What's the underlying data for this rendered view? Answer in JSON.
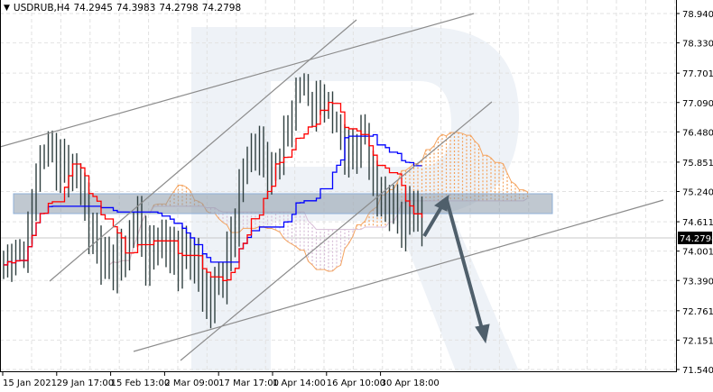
{
  "header": {
    "symbol": "USDRUB,H4",
    "open": "74.2945",
    "high": "74.3983",
    "low": "74.2798",
    "close": "74.2798"
  },
  "colors": {
    "bars": "#2f3f3f",
    "tenkan": "#ff0000",
    "kijun": "#0000ff",
    "cloud_up": "#f4a460",
    "cloud_down": "#d8bfd8",
    "trendline": "#8c8c8c",
    "arrow": "#4f5f6b",
    "zone": "#9aaab8"
  },
  "chart_data": {
    "type": "ohlc",
    "title": "USDRUB,H4",
    "indicator": "Ichimoku Kinko Hyo",
    "ylim": [
      71.5405,
      78.9405
    ],
    "y_ticks": [
      "78.9405",
      "78.3300",
      "77.7010",
      "77.0905",
      "76.4800",
      "75.8510",
      "75.2405",
      "74.6115",
      "74.0010",
      "73.3905",
      "72.7615",
      "72.1510",
      "71.5405"
    ],
    "y_tick_values": [
      78.9405,
      78.33,
      77.701,
      77.0905,
      76.48,
      75.851,
      75.2405,
      74.6115,
      74.001,
      73.3905,
      72.7615,
      72.151,
      71.5405
    ],
    "current_price": "74.2798",
    "x_ticks": [
      "15 Jan 2021",
      "29 Jan 17:00",
      "15 Feb 13:00",
      "2 Mar 09:00",
      "17 Mar 17:00",
      "1 Apr 14:00",
      "16 Apr 10:00",
      "30 Apr 18:00"
    ],
    "price_path": [
      73.79,
      73.98,
      73.88,
      74.54,
      75.66,
      76.13,
      76.04,
      75.85,
      75.66,
      75.47,
      74.91,
      74.16,
      73.79,
      73.6,
      73.98,
      73.79,
      74.73,
      74.07,
      73.88,
      74.16,
      73.98,
      73.88,
      73.88,
      73.79,
      73.41,
      72.85,
      73.23,
      73.6,
      74.54,
      75.47,
      76.04,
      76.22,
      75.85,
      75.47,
      76.41,
      76.79,
      77.72,
      77.16,
      77.16,
      77.35,
      76.79,
      76.41,
      76.04,
      76.22,
      76.41,
      75.47,
      75.1,
      74.91,
      74.63,
      74.73,
      74.91,
      74.35
    ],
    "resistance_zone": [
      75.05,
      75.45
    ],
    "forecast": {
      "up_target": 75.25,
      "down_target": 72.25
    }
  }
}
